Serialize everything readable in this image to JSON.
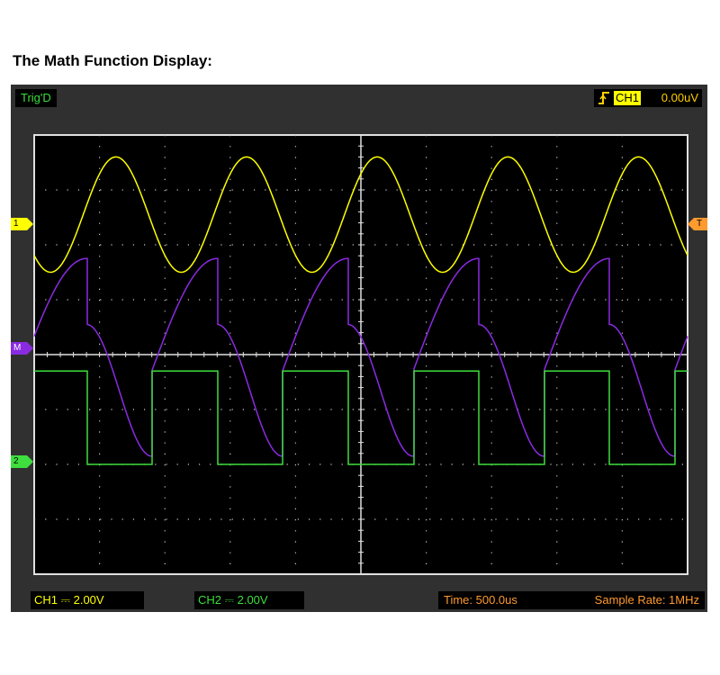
{
  "heading": "The Math Function Display:",
  "topbar": {
    "trigger_status": "Trig'D",
    "trigger_channel": "CH1",
    "trigger_level": "0.00uV"
  },
  "markers": {
    "ch1": "1",
    "math": "M",
    "ch2": "2",
    "trigger": "T"
  },
  "bottombar": {
    "ch1_scale": "CH1 ⎓  2.00V",
    "ch2_scale": "CH2 ⎓  2.00V",
    "time_base": "Time: 500.0us",
    "sample_rate": "Sample Rate: 1MHz"
  },
  "colors": {
    "ch1": "#ffff00",
    "ch2": "#3dde3d",
    "math": "#8a2be2",
    "grid": "#c8c8c8",
    "trigger": "#ff9a2e",
    "frame": "#e0e0e0"
  },
  "chart_data": {
    "type": "line",
    "grid": true,
    "divisions": {
      "x": 10,
      "y": 8
    },
    "xlim": [
      0,
      5000
    ],
    "x_unit": "us",
    "series": [
      {
        "name": "CH1",
        "waveform": "sine",
        "period_us": 1000,
        "amplitude_div": 1.05,
        "offset_div": 2.55,
        "phase": 0.1
      },
      {
        "name": "CH2",
        "waveform": "square",
        "period_us": 1000,
        "duty": 0.5,
        "high_div": -0.3,
        "low_div": -2.0,
        "phase": 0.1
      },
      {
        "name": "M",
        "waveform": "math",
        "period_us": 1000,
        "phase": 0.1
      }
    ]
  }
}
